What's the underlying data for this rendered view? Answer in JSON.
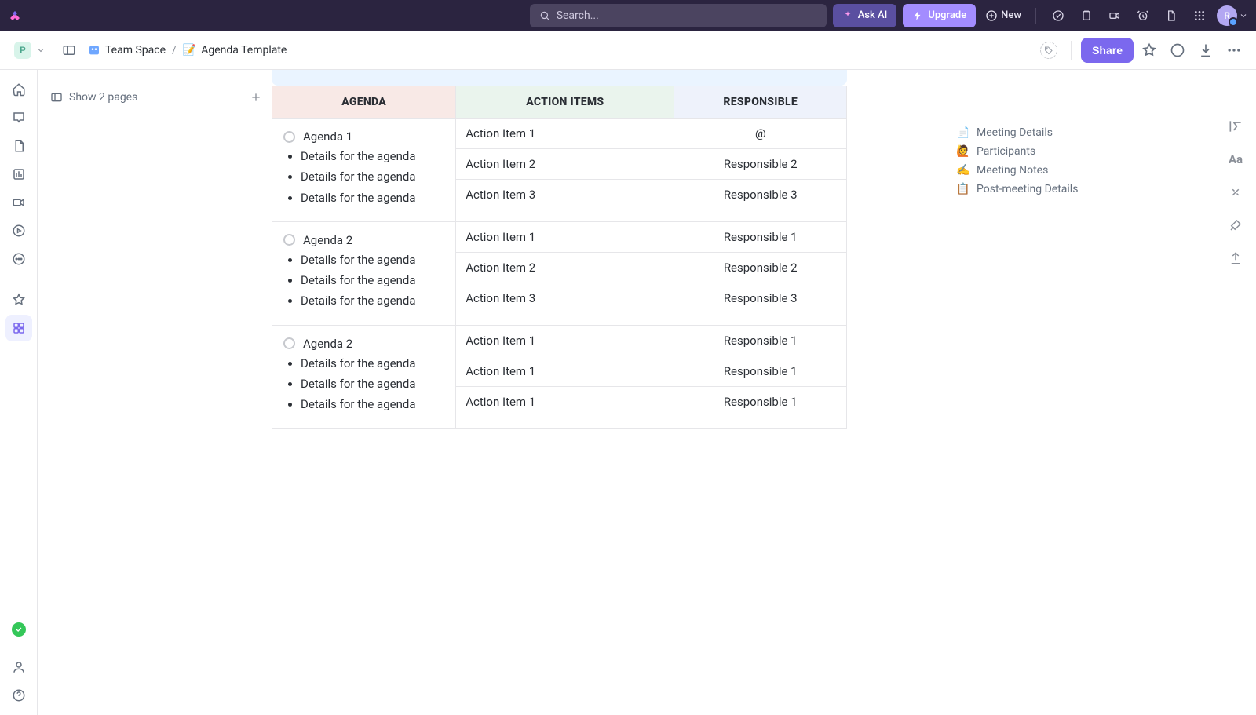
{
  "topbar": {
    "search_placeholder": "Search...",
    "ask_ai_label": "Ask AI",
    "upgrade_label": "Upgrade",
    "new_label": "New",
    "avatar_initial": "R"
  },
  "toolbar": {
    "workspace_initial": "P",
    "breadcrumb": {
      "space": "Team Space",
      "page": "Agenda Template",
      "page_emoji": "📝"
    },
    "share_label": "Share"
  },
  "pagesbar": {
    "label": "Show 2 pages"
  },
  "toc": {
    "items": [
      {
        "emoji": "📄",
        "label": "Meeting Details"
      },
      {
        "emoji": "🙋",
        "label": "Participants"
      },
      {
        "emoji": "✍️",
        "label": "Meeting Notes"
      },
      {
        "emoji": "📋",
        "label": "Post-meeting Details"
      }
    ]
  },
  "table": {
    "headers": {
      "agenda": "AGENDA",
      "action": "ACTION ITEMS",
      "responsible": "RESPONSIBLE"
    },
    "rows": [
      {
        "title": "Agenda 1",
        "details": [
          "Details for the agen­da",
          "Details for the agen­da",
          "Details for the agen­da"
        ],
        "actions": [
          "Action Item 1",
          "Action Item 2",
          "Action Item 3"
        ],
        "responsible": [
          "@",
          "Responsible 2",
          "Responsible 3"
        ]
      },
      {
        "title": "Agenda 2",
        "details": [
          "Details for the agen­da",
          "Details for the agen­da",
          "Details for the agen­da"
        ],
        "actions": [
          "Action Item 1",
          "Action Item 2",
          "Action Item 3"
        ],
        "responsible": [
          "Responsible 1",
          "Responsible 2",
          "Responsible 3"
        ]
      },
      {
        "title": "Agenda 2",
        "details": [
          "Details for the agen­da",
          "Details for the agen­da",
          "Details for the agen­da"
        ],
        "actions": [
          "Action Item 1",
          "Action Item 1",
          "Action Item 1"
        ],
        "responsible": [
          "Responsible 1",
          "Responsible 1",
          "Responsible 1"
        ]
      }
    ]
  }
}
